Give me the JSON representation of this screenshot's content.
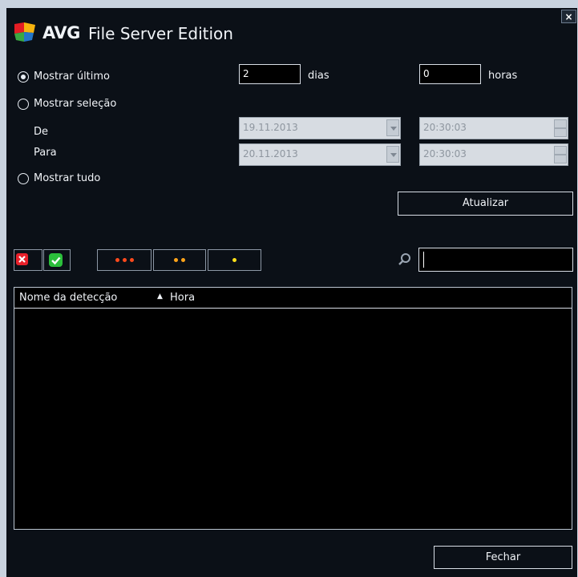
{
  "window": {
    "brand": "AVG",
    "product": "File Server Edition",
    "close_label": "×"
  },
  "filters": {
    "show_last_label": "Mostrar último",
    "days_value": "2",
    "days_label": "dias",
    "hours_value": "0",
    "hours_label": "horas",
    "show_selection_label": "Mostrar seleção",
    "from_label": "De",
    "to_label": "Para",
    "from_date": "19.11.2013",
    "from_time": "20:30:03",
    "to_date": "20.11.2013",
    "to_time": "20:30:03",
    "show_all_label": "Mostrar tudo",
    "refresh_label": "Atualizar",
    "selected": "show_last"
  },
  "toolbar": {
    "search_value": ""
  },
  "table": {
    "columns": [
      "Nome da detecção",
      "Hora"
    ],
    "sort_column": "Hora",
    "sort_direction": "ascending",
    "rows": []
  },
  "footer": {
    "close_label": "Fechar"
  },
  "colors": {
    "frame_bg": "#0b1017",
    "outer_bg": "#c9d3df",
    "high_severity": "#ff4a1c",
    "medium_severity": "#ffa41a",
    "low_severity": "#ffe11a",
    "remove_icon": "#e8202a",
    "ok_icon": "#2bbf3b"
  }
}
